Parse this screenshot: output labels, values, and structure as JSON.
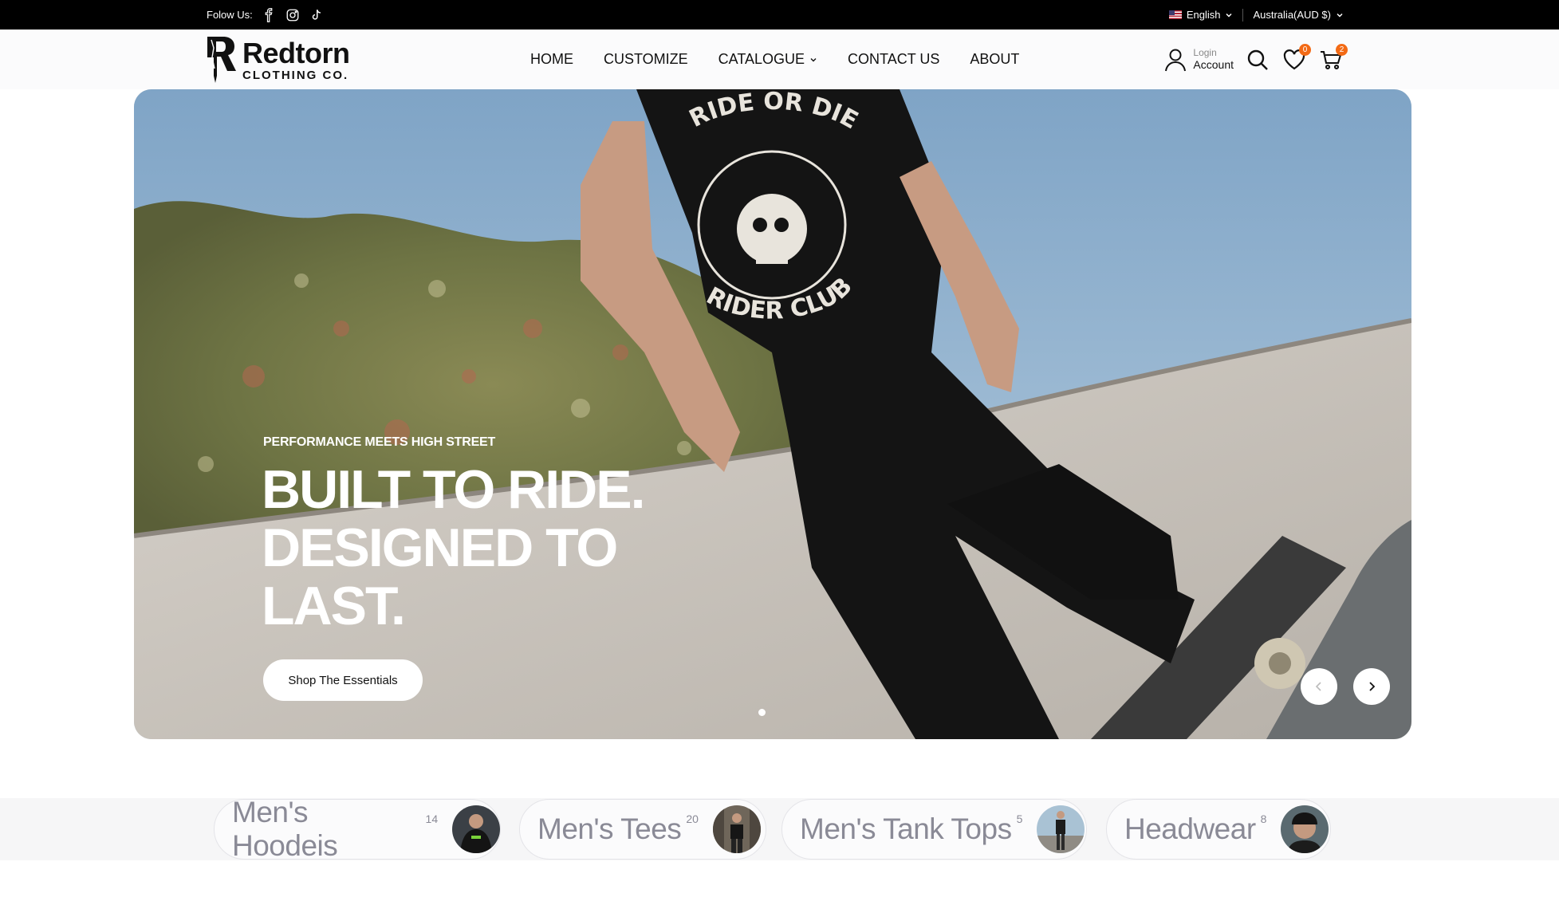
{
  "topbar": {
    "follow_label": "Folow Us:",
    "socials": [
      "facebook-icon",
      "instagram-icon",
      "tiktok-icon"
    ],
    "language": "English",
    "currency": "Australia(AUD $)"
  },
  "brand": {
    "line1": "Redtorn",
    "line2": "CLOTHING CO."
  },
  "nav": {
    "items": [
      {
        "label": "HOME"
      },
      {
        "label": "CUSTOMIZE"
      },
      {
        "label": "CATALOGUE"
      },
      {
        "label": "CONTACT US"
      },
      {
        "label": "ABOUT"
      }
    ]
  },
  "account": {
    "login_label": "Login",
    "account_label": "Account"
  },
  "wishlist": {
    "count": "0"
  },
  "cart": {
    "count": "2"
  },
  "hero": {
    "eyebrow": "PERFORMANCE MEETS HIGH STREET",
    "headline": "BUILT TO RIDE. DESIGNED TO LAST.",
    "cta": "Shop The Essentials",
    "shirt_text_top": "RIDE OR DIE",
    "shirt_text_bottom": "RIDER CLUB"
  },
  "categories": [
    {
      "name": "Men's Hoodeis",
      "count": "14"
    },
    {
      "name": "Men's Tees",
      "count": "20"
    },
    {
      "name": "Men's Tank Tops",
      "count": "5"
    },
    {
      "name": "Headwear",
      "count": "8"
    }
  ],
  "colors": {
    "accent": "#f36a15",
    "topbar": "#000000"
  }
}
